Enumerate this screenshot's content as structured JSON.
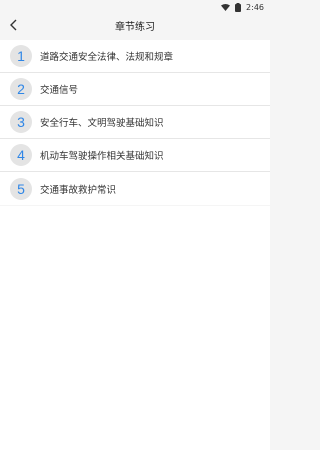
{
  "status_bar": {
    "time": "2:46"
  },
  "header": {
    "title": "章节练习"
  },
  "chapters": [
    {
      "number": "1",
      "title": "道路交通安全法律、法规和规章"
    },
    {
      "number": "2",
      "title": "交通信号"
    },
    {
      "number": "3",
      "title": "安全行车、文明驾驶基础知识"
    },
    {
      "number": "4",
      "title": "机动车驾驶操作相关基础知识"
    },
    {
      "number": "5",
      "title": "交通事故救护常识"
    }
  ],
  "colors": {
    "accent": "#2f86e6",
    "badge_bg": "#e4e4e4",
    "background": "#f5f5f5"
  }
}
